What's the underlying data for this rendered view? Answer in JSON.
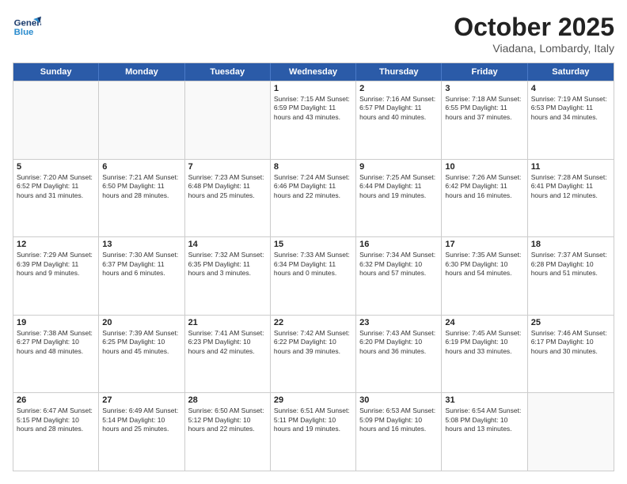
{
  "header": {
    "logo_line1": "General",
    "logo_line2": "Blue",
    "month": "October 2025",
    "location": "Viadana, Lombardy, Italy"
  },
  "weekdays": [
    "Sunday",
    "Monday",
    "Tuesday",
    "Wednesday",
    "Thursday",
    "Friday",
    "Saturday"
  ],
  "rows": [
    [
      {
        "day": "",
        "text": ""
      },
      {
        "day": "",
        "text": ""
      },
      {
        "day": "",
        "text": ""
      },
      {
        "day": "1",
        "text": "Sunrise: 7:15 AM\nSunset: 6:59 PM\nDaylight: 11 hours\nand 43 minutes."
      },
      {
        "day": "2",
        "text": "Sunrise: 7:16 AM\nSunset: 6:57 PM\nDaylight: 11 hours\nand 40 minutes."
      },
      {
        "day": "3",
        "text": "Sunrise: 7:18 AM\nSunset: 6:55 PM\nDaylight: 11 hours\nand 37 minutes."
      },
      {
        "day": "4",
        "text": "Sunrise: 7:19 AM\nSunset: 6:53 PM\nDaylight: 11 hours\nand 34 minutes."
      }
    ],
    [
      {
        "day": "5",
        "text": "Sunrise: 7:20 AM\nSunset: 6:52 PM\nDaylight: 11 hours\nand 31 minutes."
      },
      {
        "day": "6",
        "text": "Sunrise: 7:21 AM\nSunset: 6:50 PM\nDaylight: 11 hours\nand 28 minutes."
      },
      {
        "day": "7",
        "text": "Sunrise: 7:23 AM\nSunset: 6:48 PM\nDaylight: 11 hours\nand 25 minutes."
      },
      {
        "day": "8",
        "text": "Sunrise: 7:24 AM\nSunset: 6:46 PM\nDaylight: 11 hours\nand 22 minutes."
      },
      {
        "day": "9",
        "text": "Sunrise: 7:25 AM\nSunset: 6:44 PM\nDaylight: 11 hours\nand 19 minutes."
      },
      {
        "day": "10",
        "text": "Sunrise: 7:26 AM\nSunset: 6:42 PM\nDaylight: 11 hours\nand 16 minutes."
      },
      {
        "day": "11",
        "text": "Sunrise: 7:28 AM\nSunset: 6:41 PM\nDaylight: 11 hours\nand 12 minutes."
      }
    ],
    [
      {
        "day": "12",
        "text": "Sunrise: 7:29 AM\nSunset: 6:39 PM\nDaylight: 11 hours\nand 9 minutes."
      },
      {
        "day": "13",
        "text": "Sunrise: 7:30 AM\nSunset: 6:37 PM\nDaylight: 11 hours\nand 6 minutes."
      },
      {
        "day": "14",
        "text": "Sunrise: 7:32 AM\nSunset: 6:35 PM\nDaylight: 11 hours\nand 3 minutes."
      },
      {
        "day": "15",
        "text": "Sunrise: 7:33 AM\nSunset: 6:34 PM\nDaylight: 11 hours\nand 0 minutes."
      },
      {
        "day": "16",
        "text": "Sunrise: 7:34 AM\nSunset: 6:32 PM\nDaylight: 10 hours\nand 57 minutes."
      },
      {
        "day": "17",
        "text": "Sunrise: 7:35 AM\nSunset: 6:30 PM\nDaylight: 10 hours\nand 54 minutes."
      },
      {
        "day": "18",
        "text": "Sunrise: 7:37 AM\nSunset: 6:28 PM\nDaylight: 10 hours\nand 51 minutes."
      }
    ],
    [
      {
        "day": "19",
        "text": "Sunrise: 7:38 AM\nSunset: 6:27 PM\nDaylight: 10 hours\nand 48 minutes."
      },
      {
        "day": "20",
        "text": "Sunrise: 7:39 AM\nSunset: 6:25 PM\nDaylight: 10 hours\nand 45 minutes."
      },
      {
        "day": "21",
        "text": "Sunrise: 7:41 AM\nSunset: 6:23 PM\nDaylight: 10 hours\nand 42 minutes."
      },
      {
        "day": "22",
        "text": "Sunrise: 7:42 AM\nSunset: 6:22 PM\nDaylight: 10 hours\nand 39 minutes."
      },
      {
        "day": "23",
        "text": "Sunrise: 7:43 AM\nSunset: 6:20 PM\nDaylight: 10 hours\nand 36 minutes."
      },
      {
        "day": "24",
        "text": "Sunrise: 7:45 AM\nSunset: 6:19 PM\nDaylight: 10 hours\nand 33 minutes."
      },
      {
        "day": "25",
        "text": "Sunrise: 7:46 AM\nSunset: 6:17 PM\nDaylight: 10 hours\nand 30 minutes."
      }
    ],
    [
      {
        "day": "26",
        "text": "Sunrise: 6:47 AM\nSunset: 5:15 PM\nDaylight: 10 hours\nand 28 minutes."
      },
      {
        "day": "27",
        "text": "Sunrise: 6:49 AM\nSunset: 5:14 PM\nDaylight: 10 hours\nand 25 minutes."
      },
      {
        "day": "28",
        "text": "Sunrise: 6:50 AM\nSunset: 5:12 PM\nDaylight: 10 hours\nand 22 minutes."
      },
      {
        "day": "29",
        "text": "Sunrise: 6:51 AM\nSunset: 5:11 PM\nDaylight: 10 hours\nand 19 minutes."
      },
      {
        "day": "30",
        "text": "Sunrise: 6:53 AM\nSunset: 5:09 PM\nDaylight: 10 hours\nand 16 minutes."
      },
      {
        "day": "31",
        "text": "Sunrise: 6:54 AM\nSunset: 5:08 PM\nDaylight: 10 hours\nand 13 minutes."
      },
      {
        "day": "",
        "text": ""
      }
    ]
  ]
}
